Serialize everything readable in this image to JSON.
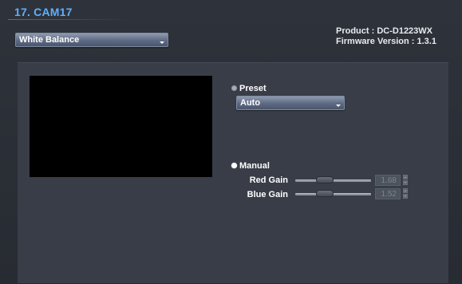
{
  "header": {
    "title": "17. CAM17",
    "product": "Product : DC-D1223WX",
    "firmware": "Firmware Version : 1.3.1"
  },
  "menu_select": {
    "value": "White Balance"
  },
  "white_balance": {
    "preset": {
      "label": "Preset",
      "selected": false,
      "dropdown_value": "Auto"
    },
    "manual": {
      "label": "Manual",
      "selected": true,
      "red_gain": {
        "label": "Red Gain",
        "value": "1.68",
        "level": 0.35
      },
      "blue_gain": {
        "label": "Blue Gain",
        "value": "1.52",
        "level": 0.35
      }
    }
  },
  "icons": {
    "dropdown_arrow": "chevron-down-icon",
    "spin_up": "chevron-up-icon",
    "spin_down": "chevron-down-icon"
  },
  "colors": {
    "title": "#5fb0ff",
    "background": "#2b2f36",
    "panel": "#383d47",
    "preview": "#000000"
  }
}
